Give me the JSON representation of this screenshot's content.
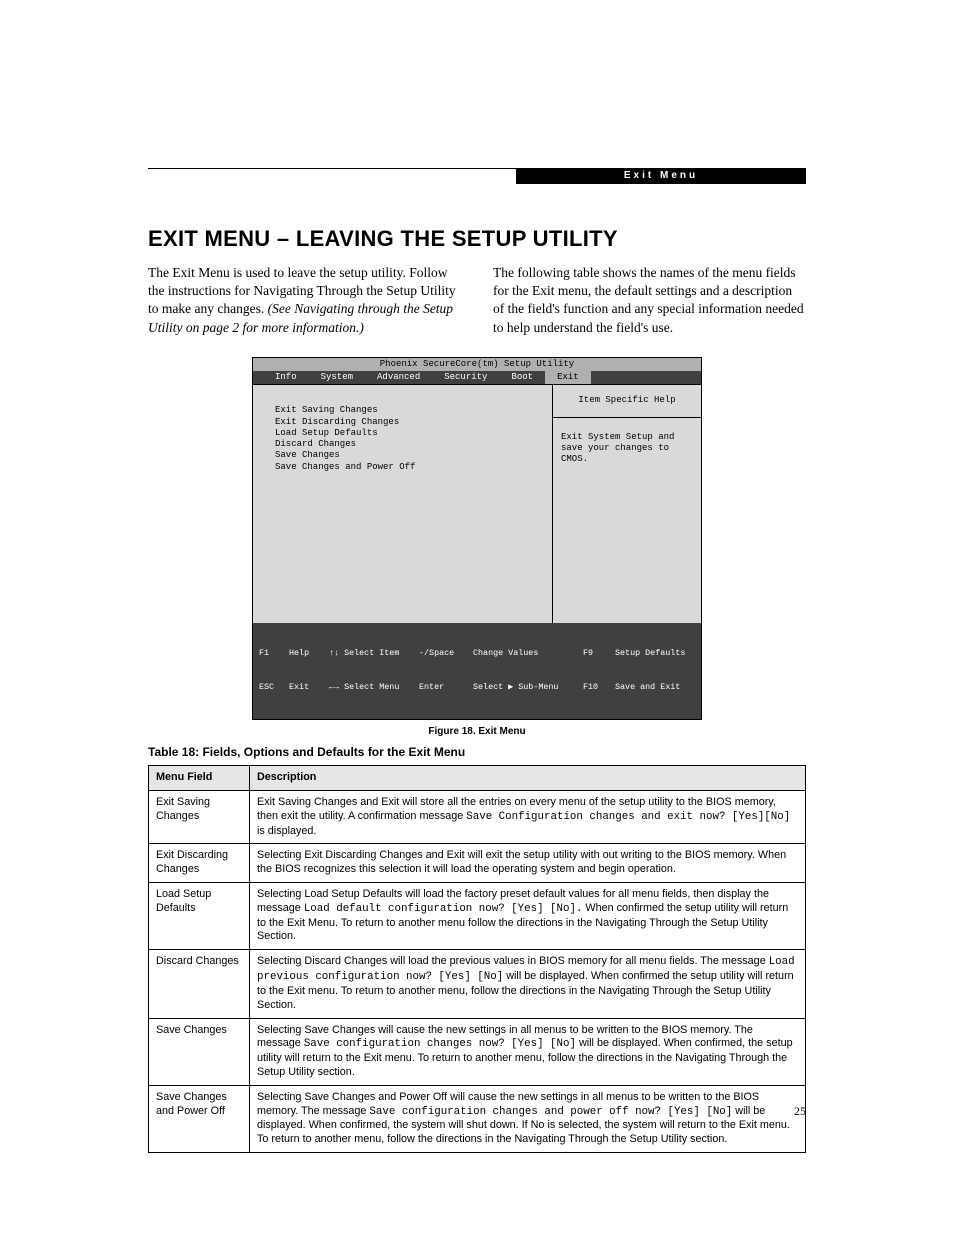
{
  "header_tab": "Exit Menu",
  "title": "EXIT MENU – LEAVING THE SETUP UTILITY",
  "intro_left_1": "The Exit Menu is used to leave the setup utility. Follow the instructions for Navigating Through the Setup Utility to make any changes. ",
  "intro_left_em": "(See Navigating through the Setup Utility on page 2 for more information.)",
  "intro_right": "The following table shows the names of the menu fields for the Exit menu, the default settings and a description of the field's function and any special information needed to help understand the field's use.",
  "bios": {
    "title": "Phoenix SecureCore(tm) Setup Utility",
    "tabs": [
      "Info",
      "System",
      "Advanced",
      "Security",
      "Boot",
      "Exit"
    ],
    "active_tab": "Exit",
    "items": [
      "Exit Saving Changes",
      "Exit Discarding Changes",
      "Load Setup Defaults",
      "Discard Changes",
      "Save Changes",
      "Save Changes and Power Off"
    ],
    "help_title": "Item Specific Help",
    "help_body": "Exit System Setup and save your changes to CMOS.",
    "footer": {
      "r1": {
        "k1": "F1",
        "v1": "Help",
        "k2": "↑↓ Select Item",
        "k3": "-/Space",
        "v3": "Change Values",
        "k4": "F9",
        "v4": "Setup Defaults"
      },
      "r2": {
        "k1": "ESC",
        "v1": "Exit",
        "k2": "←→ Select Menu",
        "k3": "Enter",
        "v3": "Select ▶ Sub-Menu",
        "k4": "F10",
        "v4": "Save and Exit"
      }
    }
  },
  "figure_caption": "Figure 18.  Exit Menu",
  "table_caption": "Table 18: Fields, Options and Defaults for the Exit Menu",
  "table": {
    "headers": [
      "Menu Field",
      "Description"
    ],
    "rows": [
      {
        "field": "Exit Saving Changes",
        "desc_parts": [
          {
            "t": "Exit Saving Changes and Exit will store all the entries on every menu of the setup utility to the BIOS memory, then exit the utility. A confirmation message "
          },
          {
            "mono": "Save Configuration changes and exit now? [Yes][No]"
          },
          {
            "t": " is displayed."
          }
        ]
      },
      {
        "field": "Exit Discarding Changes",
        "desc_parts": [
          {
            "t": "Selecting Exit Discarding Changes and Exit will exit the setup utility with out writing to the BIOS memory. When the BIOS recognizes this selection it will load the operating system and begin operation."
          }
        ]
      },
      {
        "field": "Load Setup Defaults",
        "desc_parts": [
          {
            "t": "Selecting Load Setup Defaults will load the factory preset default values for all menu fields, then display the message "
          },
          {
            "mono": "Load default configuration now? [Yes] [No]."
          },
          {
            "t": " When confirmed the setup utility will return to the Exit Menu. To return to another menu follow the directions in the Navigating Through the Setup Utility Section."
          }
        ]
      },
      {
        "field": "Discard Changes",
        "desc_parts": [
          {
            "t": "Selecting Discard Changes will load the previous values in BIOS memory for all menu fields. The message "
          },
          {
            "mono": "Load previous configuration now? [Yes] [No]"
          },
          {
            "t": " will be displayed. When confirmed the setup utility will return to the Exit menu. To return to another menu, follow the directions in the Navigating Through the Setup Utility Section."
          }
        ]
      },
      {
        "field": "Save Changes",
        "desc_parts": [
          {
            "t": "Selecting Save Changes will cause the new settings in all menus to be written to the BIOS memory. The message "
          },
          {
            "mono": "Save configuration changes now? [Yes] [No]"
          },
          {
            "t": " will be displayed. When confirmed, the setup utility will return to the Exit menu. To return to another menu, follow the directions in the Navigating Through the Setup Utility section."
          }
        ]
      },
      {
        "field": "Save Changes and Power Off",
        "desc_parts": [
          {
            "t": "Selecting Save Changes and Power Off will cause the new settings in all menus to be written to the BIOS memory. The message "
          },
          {
            "mono": "Save configuration changes and power off now? [Yes] [No]"
          },
          {
            "t": " will be displayed. When confirmed, the system will shut down. If No is selected, the system will return to the Exit menu. To return to another menu, follow the directions in the Navigating Through the Setup Utility section."
          }
        ]
      }
    ]
  },
  "page_number": "25"
}
